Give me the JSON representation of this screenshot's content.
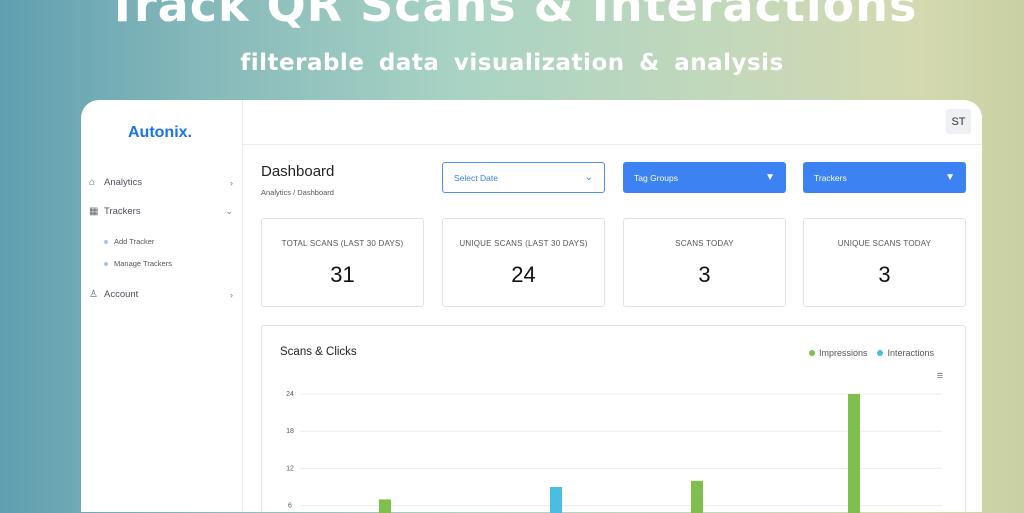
{
  "hero": {
    "title": "Track QR Scans & Interactions",
    "subtitle": "filterable data visualization & analysis"
  },
  "sidebar": {
    "logo": "Autonix.",
    "items": [
      {
        "label": "Analytics",
        "icon": "analytics-icon"
      },
      {
        "label": "Trackers",
        "icon": "qr-icon"
      },
      {
        "label": "Account",
        "icon": "user-icon"
      }
    ],
    "sub_items": [
      "Add Tracker",
      "Manage Trackers"
    ]
  },
  "header": {
    "avatar": "ST"
  },
  "page": {
    "title": "Dashboard",
    "breadcrumb": "Analytics / Dashboard"
  },
  "filters": {
    "date": "Select Date",
    "tag_groups": "Tag Groups",
    "trackers": "Trackers"
  },
  "stats": [
    {
      "label": "TOTAL SCANS (LAST 30 DAYS)",
      "value": "31"
    },
    {
      "label": "UNIQUE SCANS (LAST 30 DAYS)",
      "value": "24"
    },
    {
      "label": "SCANS TODAY",
      "value": "3"
    },
    {
      "label": "UNIQUE SCANS TODAY",
      "value": "3"
    }
  ],
  "chart_data": {
    "type": "bar",
    "title": "Scans & Clicks",
    "legend": "top-right",
    "ylim": [
      0,
      24
    ],
    "yticks": [
      "24",
      "18",
      "12",
      "6"
    ],
    "colors": {
      "Impressions": "#7fbf4d",
      "Interactions": "#4bbde0"
    },
    "series": [
      {
        "name": "Impressions",
        "values": [
          7,
          null,
          10,
          24
        ]
      },
      {
        "name": "Interactions",
        "values": [
          null,
          9,
          null,
          null
        ]
      }
    ]
  }
}
